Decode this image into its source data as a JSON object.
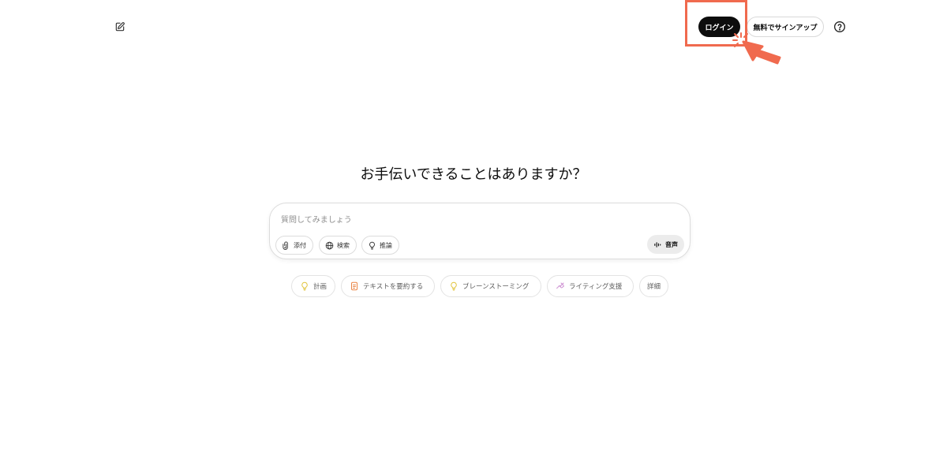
{
  "header": {
    "new_chat_icon": "edit-icon",
    "login_label": "ログイン",
    "signup_label": "無料でサインアップ",
    "help_icon": "question-circle-icon"
  },
  "main": {
    "headline": "お手伝いできることはありますか？",
    "composer": {
      "placeholder": "質問してみましょう",
      "value": "",
      "tools": [
        {
          "label": "添付",
          "icon": "paperclip-icon"
        },
        {
          "label": "検索",
          "icon": "globe-icon"
        },
        {
          "label": "推論",
          "icon": "lightbulb-icon"
        }
      ],
      "voice_label": "音声",
      "voice_icon": "waveform-icon"
    },
    "suggestions": [
      {
        "label": "計画",
        "icon": "lightbulb-icon",
        "color": "#e2c541"
      },
      {
        "label": "テキストを要約する",
        "icon": "document-icon",
        "color": "#ea8444"
      },
      {
        "label": "ブレーンストーミング",
        "icon": "lightbulb-icon",
        "color": "#e2c541"
      },
      {
        "label": "ライティング支援",
        "icon": "pen-icon",
        "color": "#cb8bd0"
      },
      {
        "label": "詳細",
        "icon": "",
        "color": ""
      }
    ]
  },
  "annotation": {
    "highlight_color": "#f06a4e",
    "target": "login-button"
  }
}
